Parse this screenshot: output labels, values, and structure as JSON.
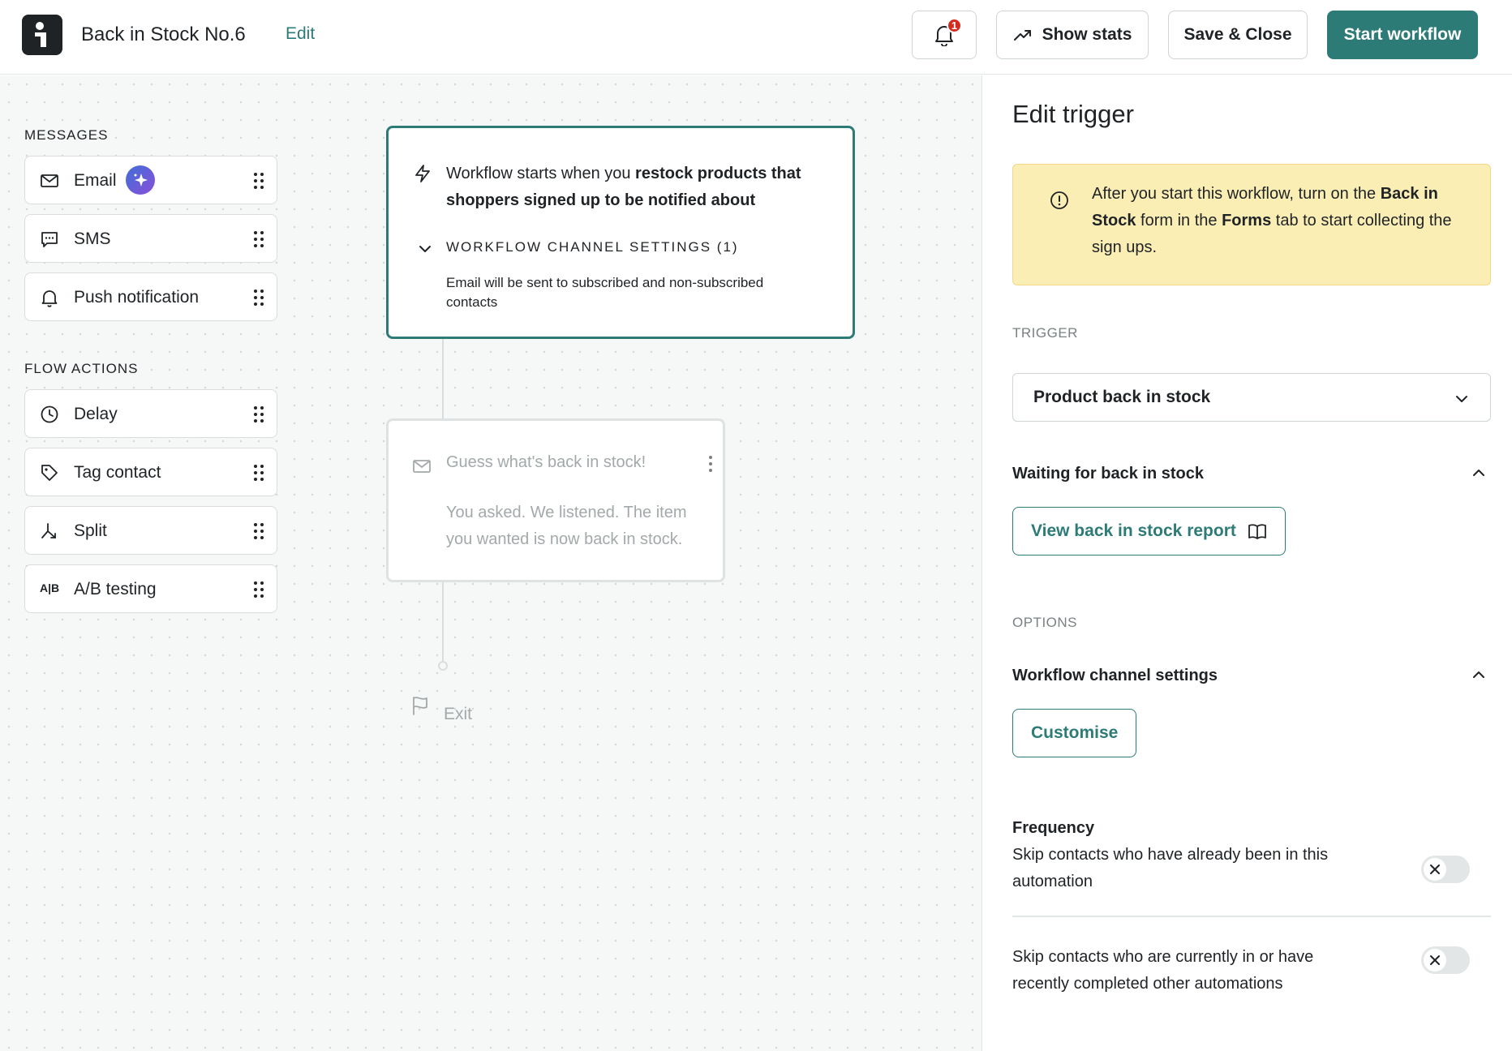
{
  "header": {
    "workflow_title": "Back in Stock No.6",
    "edit_label": "Edit",
    "notification_count": "1",
    "show_stats_label": "Show stats",
    "save_close_label": "Save & Close",
    "start_workflow_label": "Start workflow"
  },
  "palette": {
    "messages_heading": "MESSAGES",
    "messages": [
      {
        "label": "Email",
        "icon": "mail-icon"
      },
      {
        "label": "SMS",
        "icon": "chat-icon"
      },
      {
        "label": "Push notification",
        "icon": "bell-icon"
      }
    ],
    "flow_actions_heading": "FLOW ACTIONS",
    "flow_actions": [
      {
        "label": "Delay",
        "icon": "clock-icon"
      },
      {
        "label": "Tag contact",
        "icon": "tag-icon"
      },
      {
        "label": "Split",
        "icon": "split-icon"
      },
      {
        "label": "A/B testing",
        "icon": "ab-icon",
        "icon_text": "A|B"
      }
    ]
  },
  "canvas": {
    "trigger": {
      "text_prefix": "Workflow starts when you ",
      "text_bold": "restock products that shoppers signed up to be notified about",
      "channel_settings_title": "WORKFLOW CHANNEL SETTINGS (1)",
      "channel_settings_desc": "Email will be sent to subscribed and non-subscribed contacts"
    },
    "message": {
      "subject": "Guess what's back in stock!",
      "body": "You asked. We listened. The item you wanted is now back in stock."
    },
    "exit_label": "Exit"
  },
  "panel": {
    "title": "Edit trigger",
    "notice": {
      "t1": "After you start this workflow, turn on the ",
      "b1": "Back in Stock",
      "t2": " form in the ",
      "b2": "Forms",
      "t3": " tab to start collecting the sign ups."
    },
    "trigger_label": "TRIGGER",
    "trigger_value": "Product back in stock",
    "waiting_heading": "Waiting for back in stock",
    "view_report_label": "View back in stock report",
    "options_label": "OPTIONS",
    "channel_settings_heading": "Workflow channel settings",
    "customise_label": "Customise",
    "frequency_heading": "Frequency",
    "skip_already_text": "Skip contacts who have already been in this automation",
    "skip_already_on": false,
    "skip_other_text": "Skip contacts who are currently in or have recently completed other automations",
    "skip_other_on": false
  },
  "colors": {
    "accent": "#2d7b77",
    "notice_bg": "#fbeeb5",
    "badge": "#d52b1e"
  }
}
